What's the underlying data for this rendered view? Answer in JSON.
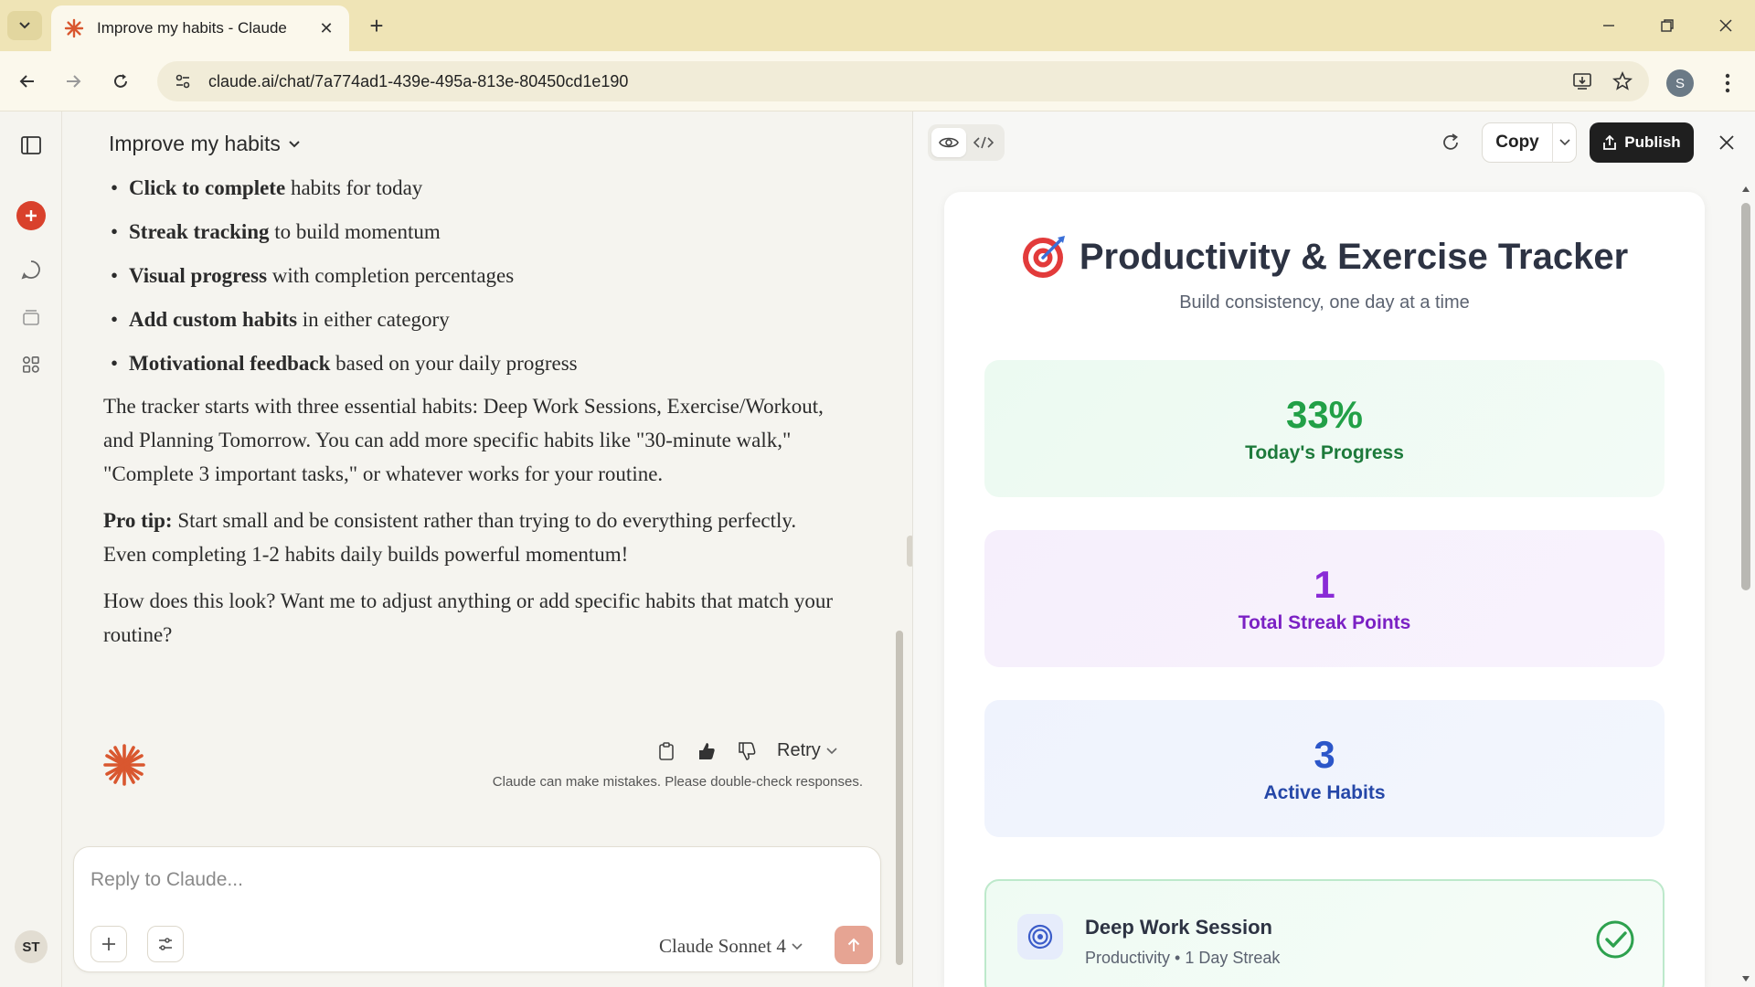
{
  "browser": {
    "tab_title": "Improve my habits - Claude",
    "url": "claude.ai/chat/7a774ad1-439e-495a-813e-80450cd1e190",
    "profile_initial": "S",
    "theme_color": "#efe4b6"
  },
  "rail": {
    "user_initials": "ST",
    "accent": "#d9412c"
  },
  "chat": {
    "title": "Improve my habits",
    "bullets": [
      {
        "bold": "Click to complete",
        "rest": " habits for today"
      },
      {
        "bold": "Streak tracking",
        "rest": " to build momentum"
      },
      {
        "bold": "Visual progress",
        "rest": " with completion percentages"
      },
      {
        "bold": "Add custom habits",
        "rest": " in either category"
      },
      {
        "bold": "Motivational feedback",
        "rest": " based on your daily progress"
      }
    ],
    "paragraph1": "The tracker starts with three essential habits: Deep Work Sessions, Exercise/Workout, and Planning Tomorrow. You can add more specific habits like \"30-minute walk,\" \"Complete 3 important tasks,\" or whatever works for your routine.",
    "protip_label": "Pro tip:",
    "protip_text": " Start small and be consistent rather than trying to do everything perfectly. Even completing 1-2 habits daily builds powerful momentum!",
    "question": "How does this look? Want me to adjust anything or add specific habits that match your routine?",
    "retry_label": "Retry",
    "disclaimer": "Claude can make mistakes. Please double-check responses.",
    "composer_placeholder": "Reply to Claude...",
    "model_name": "Claude Sonnet 4"
  },
  "artifact": {
    "copy_label": "Copy",
    "publish_label": "Publish",
    "heading": "Productivity & Exercise Tracker",
    "subtitle": "Build consistency, one day at a time",
    "stats": [
      {
        "value": "33%",
        "label": "Today's Progress",
        "color": "#22a047"
      },
      {
        "value": "1",
        "label": "Total Streak Points",
        "color": "#8a2bd6"
      },
      {
        "value": "3",
        "label": "Active Habits",
        "color": "#2c56c9"
      }
    ],
    "habit": {
      "name": "Deep Work Session",
      "meta": "Productivity • 1 Day Streak",
      "completed": true,
      "icon": "target-icon"
    }
  }
}
